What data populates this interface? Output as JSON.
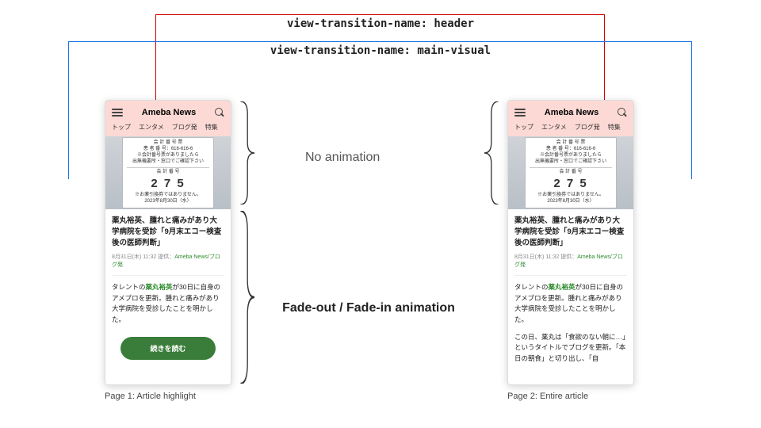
{
  "prop_header": "view-transition-name: header",
  "prop_visual": "view-transition-name: main-visual",
  "annotation_top": "No animation",
  "annotation_bottom": "Fade-out / Fade-in animation",
  "caption_left": "Page 1: Article highlight",
  "caption_right": "Page 2: Entire article",
  "phone": {
    "brand": "Ameba News",
    "tabs": [
      "トップ",
      "エンタメ",
      "ブログ発",
      "特集"
    ],
    "ticket": {
      "title": "会 計 番 号 票",
      "sub": "患 者 番 号：616-616-6",
      "note1": "※会計番号票がありましたら",
      "note2": "出無機要所・窓口でご確認下さい",
      "label": "会 計 番 号",
      "number": "2 7 5",
      "foot": "※お薬引換券ではありません。",
      "date": "2023年8月30日（水）"
    },
    "headline": "薬丸裕英、腫れと痛みがあり大学病院を受診「9月末エコー検査後の医師判断」",
    "meta_date": "8月31日(木) 11:32",
    "meta_joiner": "  提供：",
    "meta_source": "Ameba News/ブログ発",
    "paragraph_pre": "タレントの",
    "paragraph_name": "薬丸裕英",
    "paragraph_post": "が30日に自身のアメブロを更新。腫れと痛みがあり大学病院を受診したことを明かした。",
    "paragraph2": "この日、薬丸は「食欲のない朝に…」というタイトルでブログを更新。「本日の朝食」と切り出し、「自",
    "cta": "続きを読む"
  }
}
